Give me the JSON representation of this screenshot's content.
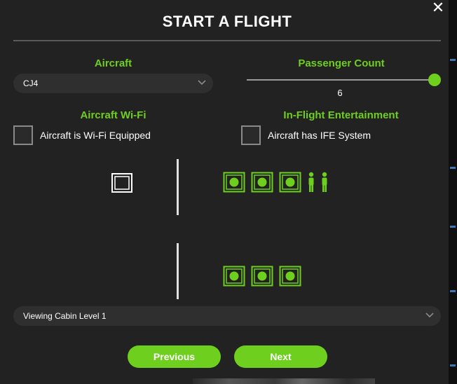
{
  "dialog": {
    "title": "START A FLIGHT",
    "close_icon": "close-icon",
    "close_glyph": "✕"
  },
  "aircraft": {
    "label": "Aircraft",
    "selected": "CJ4"
  },
  "passengers": {
    "label": "Passenger Count",
    "value": "6",
    "fraction": 1.0
  },
  "wifi": {
    "label": "Aircraft Wi-Fi",
    "checkbox_label": "Aircraft is Wi-Fi Equipped",
    "checked": false
  },
  "ife": {
    "label": "In-Flight Entertainment",
    "checkbox_label": "Aircraft has IFE System",
    "checked": false
  },
  "cabin": {
    "upper_row_seats": 3,
    "upper_row_crew": 2,
    "lower_row_seats": 3,
    "level_selected": "Viewing Cabin Level 1"
  },
  "buttons": {
    "previous": "Previous",
    "next": "Next"
  },
  "colors": {
    "accent": "#6fcf1f",
    "background": "#222222",
    "field": "#2f2f2f"
  }
}
